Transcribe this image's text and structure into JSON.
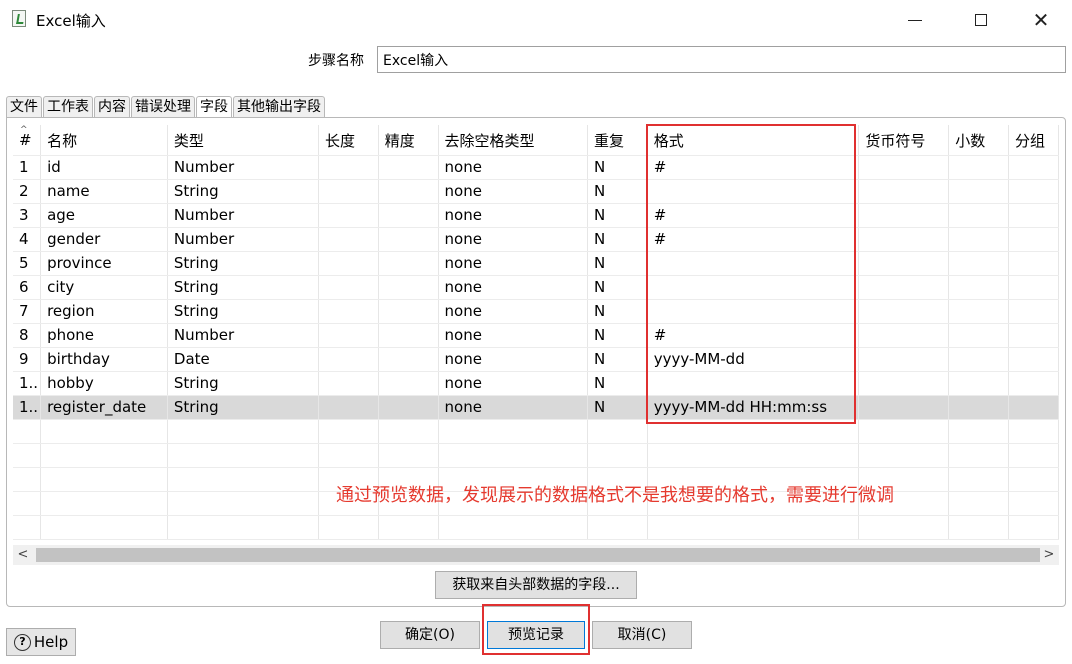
{
  "window": {
    "title": "Excel输入"
  },
  "step": {
    "label": "步骤名称",
    "value": "Excel输入"
  },
  "tabs": [
    {
      "label": "文件",
      "active": false
    },
    {
      "label": "工作表",
      "active": false
    },
    {
      "label": "内容",
      "active": false
    },
    {
      "label": "错误处理",
      "active": false
    },
    {
      "label": "字段",
      "active": true
    },
    {
      "label": "其他输出字段",
      "active": false
    }
  ],
  "table": {
    "columns": [
      "#",
      "名称",
      "类型",
      "长度",
      "精度",
      "去除空格类型",
      "重复",
      "格式",
      "货币符号",
      "小数",
      "分组"
    ],
    "rows": [
      [
        "1",
        "id",
        "Number",
        "",
        "",
        "none",
        "N",
        "#",
        "",
        "",
        ""
      ],
      [
        "2",
        "name",
        "String",
        "",
        "",
        "none",
        "N",
        "",
        "",
        "",
        ""
      ],
      [
        "3",
        "age",
        "Number",
        "",
        "",
        "none",
        "N",
        "#",
        "",
        "",
        ""
      ],
      [
        "4",
        "gender",
        "Number",
        "",
        "",
        "none",
        "N",
        "#",
        "",
        "",
        ""
      ],
      [
        "5",
        "province",
        "String",
        "",
        "",
        "none",
        "N",
        "",
        "",
        "",
        ""
      ],
      [
        "6",
        "city",
        "String",
        "",
        "",
        "none",
        "N",
        "",
        "",
        "",
        ""
      ],
      [
        "7",
        "region",
        "String",
        "",
        "",
        "none",
        "N",
        "",
        "",
        "",
        ""
      ],
      [
        "8",
        "phone",
        "Number",
        "",
        "",
        "none",
        "N",
        "#",
        "",
        "",
        ""
      ],
      [
        "9",
        "birthday",
        "Date",
        "",
        "",
        "none",
        "N",
        "yyyy-MM-dd",
        "",
        "",
        ""
      ],
      [
        "1..",
        "hobby",
        "String",
        "",
        "",
        "none",
        "N",
        "",
        "",
        "",
        ""
      ],
      [
        "1..",
        "register_date",
        "String",
        "",
        "",
        "none",
        "N",
        "yyyy-MM-dd HH:mm:ss",
        "",
        "",
        ""
      ]
    ],
    "selected_row": 10
  },
  "annotation": "通过预览数据，发现展示的数据格式不是我想要的格式，需要进行微调",
  "buttons": {
    "get_fields": "获取来自头部数据的字段...",
    "ok": "确定(O)",
    "preview": "预览记录",
    "cancel": "取消(C)",
    "help": "Help"
  },
  "colors": {
    "highlight": "#e03030",
    "annotation": "#e53a2f",
    "selected_row": "#d9d9d9"
  }
}
